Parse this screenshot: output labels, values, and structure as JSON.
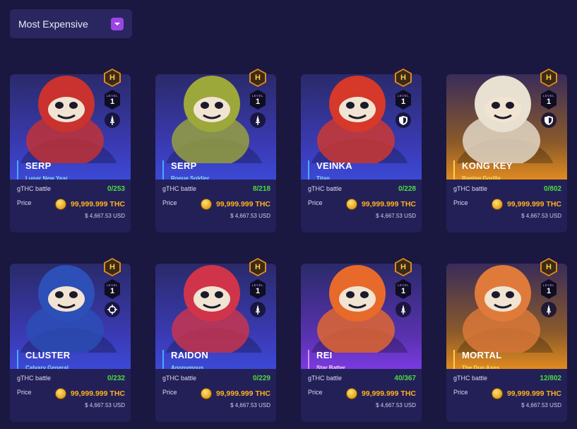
{
  "sort": {
    "label": "Most Expensive"
  },
  "labels": {
    "battle": "gTHC battle",
    "price": "Price",
    "level": "LEVEL"
  },
  "cards": [
    {
      "name": "SERP",
      "subtitle": "Lunar New Year",
      "battle": "0/253",
      "price": "99,999.999 THC",
      "usd": "$ 4,667.53 USD",
      "badge": "H",
      "level": "1",
      "class_icon": "sword-icon",
      "theme": "blue",
      "hero_color": "#c9322f"
    },
    {
      "name": "SERP",
      "subtitle": "Rogue Soldier",
      "battle": "8/218",
      "price": "99,999.999 THC",
      "usd": "$ 4,667.53 USD",
      "badge": "H",
      "level": "1",
      "class_icon": "sword-icon",
      "theme": "blue",
      "hero_color": "#9ca83a"
    },
    {
      "name": "VEINKA",
      "subtitle": "Titan",
      "battle": "0/228",
      "price": "99,999.999 THC",
      "usd": "$ 4,667.53 USD",
      "badge": "H",
      "level": "1",
      "class_icon": "shield-icon",
      "theme": "blue",
      "hero_color": "#d6382a"
    },
    {
      "name": "KONG KEY",
      "subtitle": "Raging Gorilla",
      "battle": "0/802",
      "price": "99,999.999 THC",
      "usd": "$ 4,667.53 USD",
      "badge": "H",
      "level": "1",
      "class_icon": "shield-icon",
      "theme": "gold",
      "hero_color": "#e8e0d0"
    },
    {
      "name": "CLUSTER",
      "subtitle": "Calvary General",
      "battle": "0/232",
      "price": "99,999.999 THC",
      "usd": "$ 4,667.53 USD",
      "badge": "H",
      "level": "1",
      "class_icon": "crosshair-icon",
      "theme": "blue",
      "hero_color": "#2c4fb8"
    },
    {
      "name": "RAIDON",
      "subtitle": "Anonymous",
      "battle": "0/229",
      "price": "99,999.999 THC",
      "usd": "$ 4,667.53 USD",
      "badge": "H",
      "level": "1",
      "class_icon": "sword-icon",
      "theme": "blue",
      "hero_color": "#d0344a"
    },
    {
      "name": "REI",
      "subtitle": "Star Batter",
      "battle": "40/367",
      "price": "99,999.999 THC",
      "usd": "$ 4,667.53 USD",
      "badge": "H",
      "level": "1",
      "class_icon": "sword-icon",
      "theme": "purple",
      "hero_color": "#e86a2a"
    },
    {
      "name": "MORTAL",
      "subtitle": "The Duo Axes",
      "battle": "12/802",
      "price": "99,999.999 THC",
      "usd": "$ 4,667.53 USD",
      "badge": "H",
      "level": "1",
      "class_icon": "sword-icon",
      "theme": "gold",
      "hero_color": "#e07a3a"
    }
  ]
}
